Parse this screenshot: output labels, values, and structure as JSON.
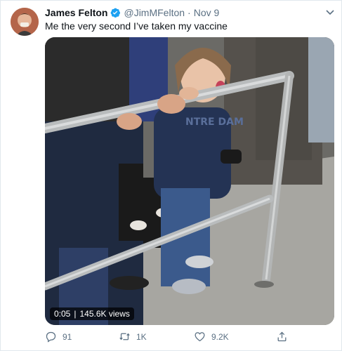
{
  "author": {
    "display_name": "James Felton",
    "handle": "@JimMFelton",
    "date": "Nov 9",
    "verified": true
  },
  "separator": "·",
  "tweet": {
    "text": "Me the very second I’ve taken my vaccine"
  },
  "video": {
    "time": "0:05",
    "views": "145.6K views"
  },
  "actions": {
    "replies": "91",
    "retweets": "1K",
    "likes": "9.2K"
  },
  "colors": {
    "verified_blue": "#1da1f2",
    "secondary_text": "#5b7083",
    "primary_text": "#0f1419"
  },
  "icons": [
    "verified-badge-icon",
    "chevron-down-icon",
    "reply-icon",
    "retweet-icon",
    "like-icon",
    "share-icon"
  ]
}
